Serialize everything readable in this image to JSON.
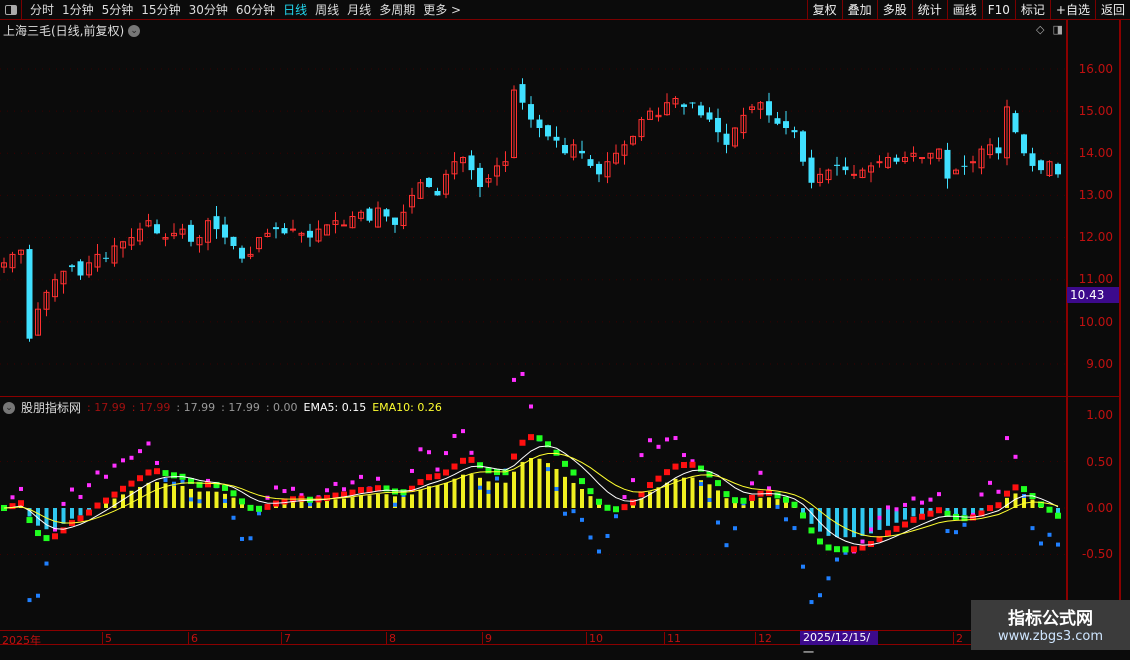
{
  "toolbar": {
    "periods": [
      "分时",
      "1分钟",
      "5分钟",
      "15分钟",
      "30分钟",
      "60分钟",
      "日线",
      "周线",
      "月线",
      "多周期",
      "更多 >"
    ],
    "active_period": "日线",
    "buttons": [
      "复权",
      "叠加",
      "多股",
      "统计",
      "画线",
      "F10",
      "标记",
      "+自选",
      "返回"
    ]
  },
  "main": {
    "title": "上海三毛(日线,前复权)",
    "price_axis": [
      "16.00",
      "15.00",
      "14.00",
      "13.00",
      "12.00",
      "11.00",
      "10.00",
      "9.00"
    ],
    "cursor_price": "10.43",
    "closes": [
      11.4,
      11.6,
      11.7,
      9.6,
      10.3,
      10.7,
      11.0,
      11.2,
      11.3,
      11.1,
      11.4,
      11.6,
      11.5,
      11.8,
      11.9,
      12.0,
      12.2,
      12.4,
      12.1,
      12.0,
      12.1,
      12.2,
      11.9,
      12.0,
      12.4,
      12.2,
      12.0,
      11.8,
      11.5,
      11.6,
      12.0,
      12.1,
      12.2,
      12.1,
      12.2,
      12.1,
      12.0,
      12.2,
      12.3,
      12.4,
      12.3,
      12.5,
      12.6,
      12.4,
      12.7,
      12.5,
      12.3,
      12.6,
      13.0,
      13.3,
      13.2,
      13.0,
      13.5,
      13.8,
      13.9,
      13.6,
      13.2,
      13.4,
      13.7,
      13.8,
      15.5,
      15.2,
      14.8,
      14.6,
      14.4,
      14.3,
      14.0,
      14.2,
      14.0,
      13.7,
      13.5,
      13.8,
      14.0,
      14.2,
      14.4,
      14.8,
      15.0,
      14.9,
      15.2,
      15.3,
      15.1,
      15.2,
      14.9,
      14.8,
      14.5,
      14.2,
      14.6,
      14.9,
      15.1,
      15.2,
      14.9,
      14.7,
      14.6,
      14.5,
      13.8,
      13.3,
      13.5,
      13.6,
      13.7,
      13.6,
      13.5,
      13.6,
      13.7,
      13.8,
      13.9,
      13.8,
      13.9,
      14.0,
      13.9,
      14.0,
      14.1,
      13.4,
      13.6,
      13.7,
      13.8,
      14.1,
      14.2,
      14.0,
      15.1,
      14.5,
      14.0,
      13.7,
      13.6,
      13.8,
      13.5
    ],
    "colors": {
      "up": "#ff3030",
      "down": "#40e0ff"
    }
  },
  "indicator": {
    "name": "股朋指标网",
    "values": [
      ": 17.99",
      ": 17.99",
      ": 17.99",
      ": 17.99",
      ": 0.00"
    ],
    "ema5_label": "EMA5:",
    "ema5": "0.15",
    "ema10_label": "EMA10:",
    "ema10": "0.26",
    "axis": [
      "1.00",
      "0.50",
      "0.00",
      "-0.50"
    ]
  },
  "dates": {
    "labels": [
      "2025年",
      "5",
      "6",
      "7",
      "8",
      "9",
      "10",
      "11",
      "12",
      "2"
    ],
    "cursor": "2025/12/15/一"
  },
  "watermark": {
    "title": "指标公式网",
    "url": "www.zbgs3.com"
  }
}
